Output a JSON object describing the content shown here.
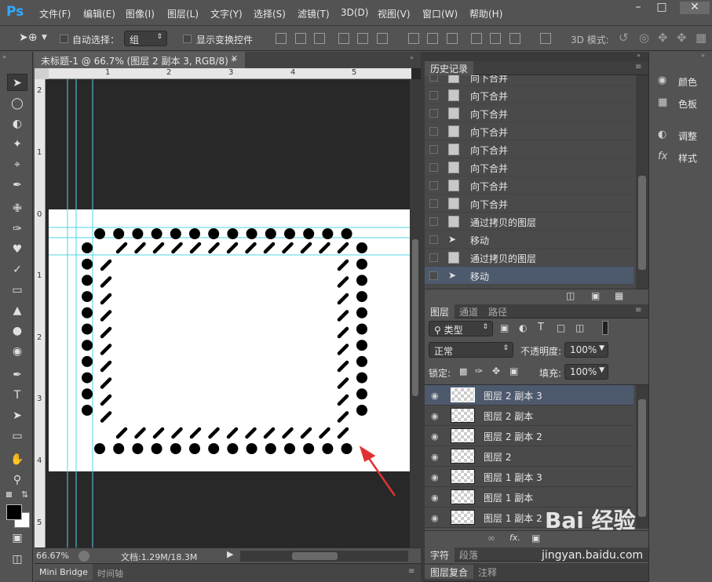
{
  "app": {
    "logo": "Ps",
    "menu": [
      "文件(F)",
      "编辑(E)",
      "图像(I)",
      "图层(L)",
      "文字(Y)",
      "选择(S)",
      "滤镜(T)",
      "3D(D)",
      "视图(V)",
      "窗口(W)",
      "帮助(H)"
    ],
    "window_controls": [
      "minimize-icon",
      "maximize-icon",
      "close-icon"
    ]
  },
  "options": {
    "auto_select_label": "自动选择：",
    "auto_select_value": "组",
    "show_transform_label": "显示变换控件",
    "mode_3d_label": "3D 模式:"
  },
  "document": {
    "tab_title": "未标题-1 @ 66.7% (图层 2 副本 3, RGB/8) *",
    "hruler": [
      "1",
      "2",
      "3",
      "4",
      "5"
    ],
    "vruler": [
      "2",
      "1",
      "0",
      "1",
      "2",
      "3",
      "4",
      "5"
    ],
    "zoom": "66.67%",
    "doc_info": "文档:1.29M/18.3M"
  },
  "bottom_tabs": [
    "Mini Bridge",
    "时间轴"
  ],
  "history": {
    "tab": "历史记录",
    "items": [
      {
        "label": "向下合并",
        "icon": "doc-icon"
      },
      {
        "label": "向下合并",
        "icon": "doc-icon"
      },
      {
        "label": "向下合并",
        "icon": "doc-icon"
      },
      {
        "label": "向下合并",
        "icon": "doc-icon"
      },
      {
        "label": "向下合并",
        "icon": "doc-icon"
      },
      {
        "label": "向下合并",
        "icon": "doc-icon"
      },
      {
        "label": "向下合并",
        "icon": "doc-icon"
      },
      {
        "label": "向下合并",
        "icon": "doc-icon"
      },
      {
        "label": "通过拷贝的图层",
        "icon": "doc-icon"
      },
      {
        "label": "移动",
        "icon": "move-icon"
      },
      {
        "label": "通过拷贝的图层",
        "icon": "doc-icon"
      },
      {
        "label": "移动",
        "icon": "move-icon",
        "selected": true
      }
    ]
  },
  "layers": {
    "tabs": [
      "图层",
      "通道",
      "路径"
    ],
    "filter_label": "类型",
    "blend_mode": "正常",
    "opacity_label": "不透明度:",
    "opacity_value": "100%",
    "lock_label": "锁定:",
    "fill_label": "填充:",
    "fill_value": "100%",
    "items": [
      {
        "name": "图层 2 副本 3",
        "selected": true
      },
      {
        "name": "图层 2 副本"
      },
      {
        "name": "图层 2 副本 2"
      },
      {
        "name": "图层 2"
      },
      {
        "name": "图层 1 副本 3"
      },
      {
        "name": "图层 1 副本"
      },
      {
        "name": "图层 1 副本 2"
      }
    ]
  },
  "right_tabs_bottom": [
    "字符",
    "段落"
  ],
  "right_tabs_bottom2": [
    "图层复合",
    "注释"
  ],
  "side_panel": [
    {
      "label": "颜色",
      "icon": "palette-icon"
    },
    {
      "label": "色板",
      "icon": "swatches-icon"
    },
    {
      "label": "调整",
      "icon": "adjust-icon"
    },
    {
      "label": "样式",
      "icon": "fx-icon"
    }
  ],
  "watermark": {
    "brand": "Bai 经验",
    "url": "jingyan.baidu.com"
  },
  "colors": {
    "accent": "#31a8ff",
    "guide": "#4fd5e6",
    "selection": "#4d5a6e"
  }
}
